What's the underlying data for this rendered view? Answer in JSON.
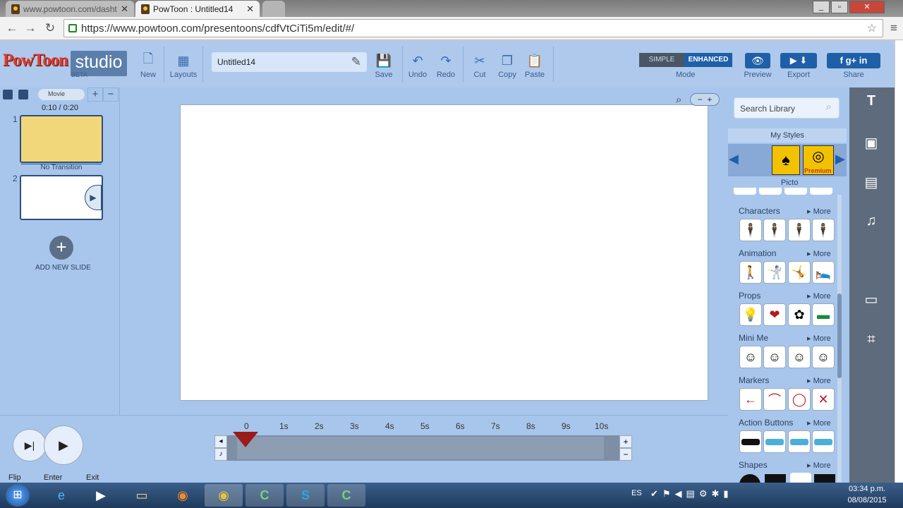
{
  "browser": {
    "tabs": [
      {
        "title": "www.powtoon.com/dasht",
        "active": false
      },
      {
        "title": "PowToon : Untitled14",
        "active": true
      }
    ],
    "url": "https://www.powtoon.com/presentoons/cdfVtCiTi5m/edit/#/",
    "window_buttons": [
      "_",
      "▫",
      "✕"
    ]
  },
  "app": {
    "logo": "PowToon",
    "studio": "studio",
    "beta": "BETA",
    "toolbar": {
      "new": "New",
      "layouts": "Layouts",
      "title_value": "Untitled14",
      "save": "Save",
      "undo": "Undo",
      "redo": "Redo",
      "cut": "Cut",
      "copy": "Copy",
      "paste": "Paste",
      "mode_simple": "SIMPLE",
      "mode_enhanced": "ENHANCED",
      "mode_label": "Mode",
      "preview": "Preview",
      "export": "Export",
      "share": "Share"
    },
    "slides_panel": {
      "movie_label": "Movie",
      "time": "0:10 / 0:20",
      "slide1_num": "1",
      "transition": "No Transition",
      "slide2_num": "2",
      "add_slide": "ADD NEW SLIDE"
    },
    "library": {
      "search_placeholder": "Search Library",
      "my_styles": "My Styles",
      "style_name": "Picto",
      "premium": "Premium",
      "more_label": "More",
      "categories": [
        "Characters",
        "Animation",
        "Props",
        "Mini Me",
        "Markers",
        "Action Buttons",
        "Shapes"
      ]
    },
    "timeline": {
      "ticks": [
        "0",
        "1s",
        "2s",
        "3s",
        "4s",
        "5s",
        "6s",
        "7s",
        "8s",
        "9s",
        "10s"
      ]
    },
    "bottom_labels": [
      "Flip",
      "Enter",
      "Exit"
    ]
  },
  "taskbar": {
    "lang": "ES",
    "time": "03:34 p.m.",
    "date": "08/08/2015"
  },
  "colors": {
    "panel": "#a8c6ec",
    "accent": "#3a6ab0",
    "enhanced": "#1f5fa8"
  }
}
